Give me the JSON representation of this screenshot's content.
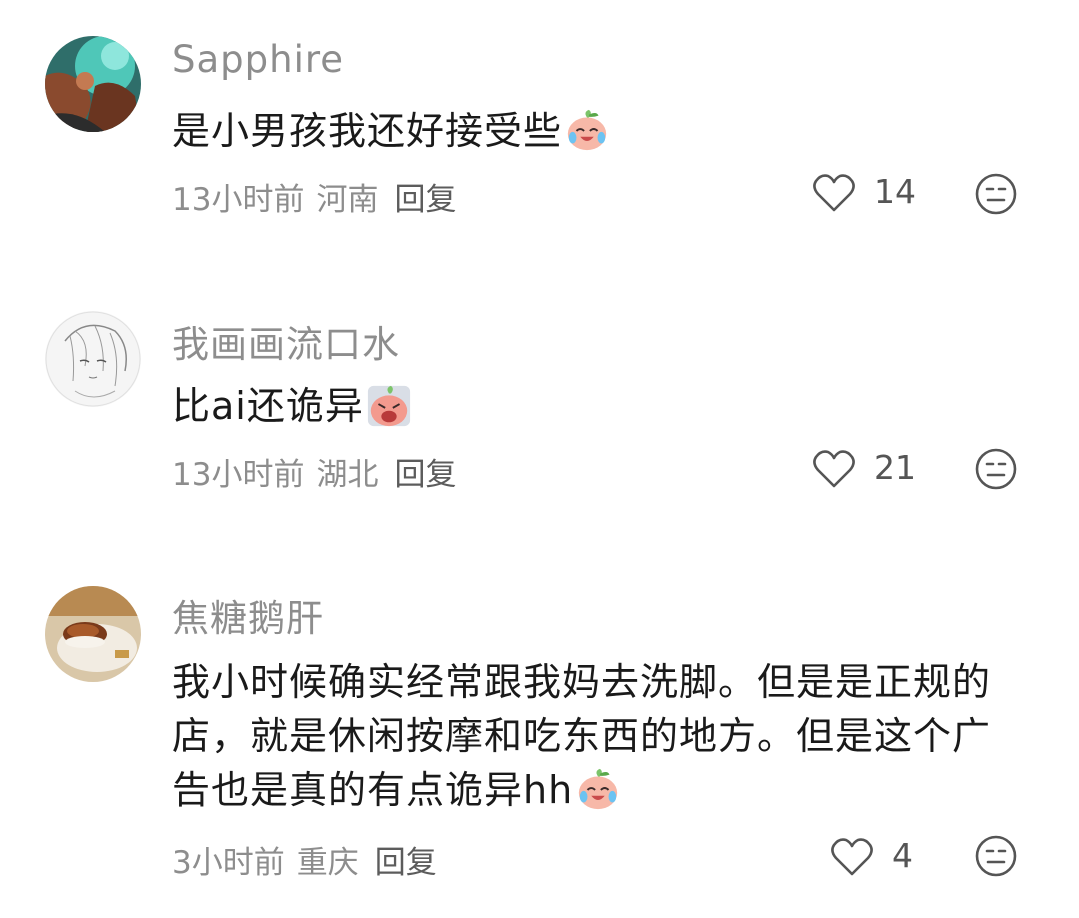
{
  "comments": [
    {
      "username": "Sapphire",
      "text": "是小男孩我还好接受些",
      "emoji": "crying-laughing-peach-emoji",
      "time": "13小时前",
      "location": "河南",
      "reply_label": "回复",
      "likes": "14"
    },
    {
      "username": "我画画流口水",
      "text": "比ai还诡异",
      "emoji": "wailing-peach-emoji",
      "time": "13小时前",
      "location": "湖北",
      "reply_label": "回复",
      "likes": "21"
    },
    {
      "username": "焦糖鹅肝",
      "text": "我小时候确实经常跟我妈去洗脚。但是是正规的店，就是休闲按摩和吃东西的地方。但是这个广告也是真的有点诡异hh",
      "emoji": "crying-laughing-peach-emoji",
      "time": "3小时前",
      "location": "重庆",
      "reply_label": "回复",
      "likes": "4"
    }
  ],
  "icons": {
    "like": "heart-outline-icon",
    "dislike": "meh-face-icon"
  },
  "colors": {
    "username": "#8d8d8d",
    "text": "#1a1a1a",
    "meta": "#8d8d8d",
    "icon": "#555555"
  }
}
